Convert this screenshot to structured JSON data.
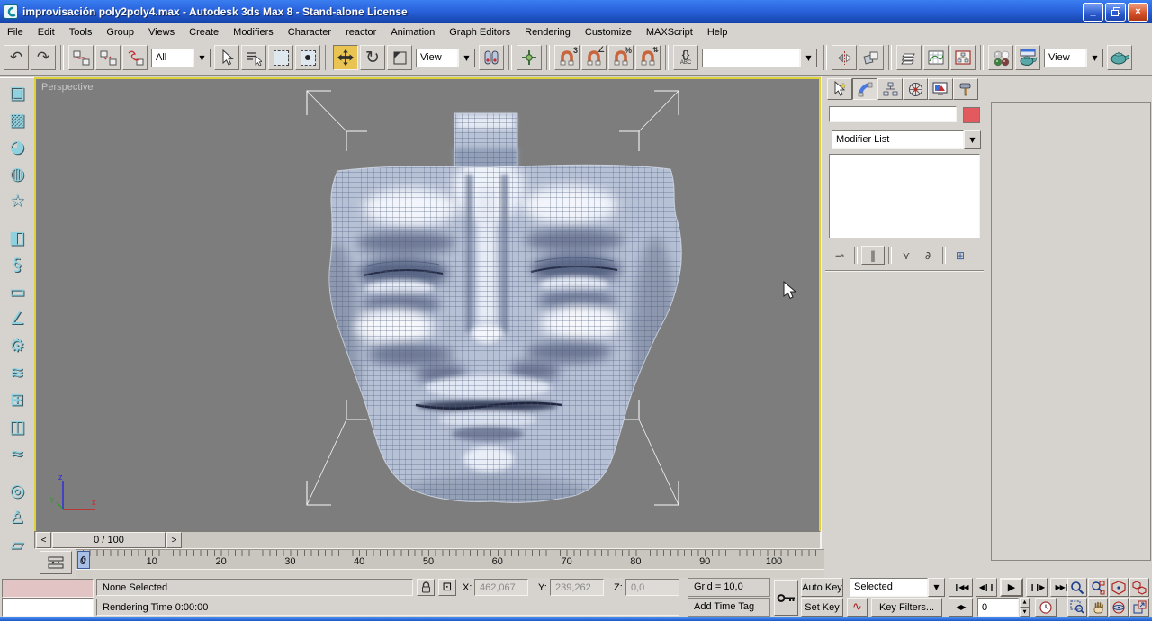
{
  "window": {
    "title": "improvisación poly2poly4.max - Autodesk 3ds Max 8  - Stand-alone License",
    "minimize_glyph": "_",
    "close_glyph": "×"
  },
  "menu": {
    "items": [
      "File",
      "Edit",
      "Tools",
      "Group",
      "Views",
      "Create",
      "Modifiers",
      "Character",
      "reactor",
      "Animation",
      "Graph Editors",
      "Rendering",
      "Customize",
      "MAXScript",
      "Help"
    ]
  },
  "toolbar": {
    "undo_glyph": "↶",
    "redo_glyph": "↷",
    "selection_filter": "All",
    "coord_system": "View",
    "rotate_glyph": "↻",
    "snap_label": "3",
    "angle_glyph": "∠",
    "percent_label": "%",
    "spinner_glyph": "⇅",
    "named_sel_braces": "{}",
    "named_sel_abc": "ABC",
    "named_selection_value": "",
    "render_type": "View",
    "dropdown_glyph": "▼"
  },
  "left_toolbar": {
    "items": [
      {
        "name": "reactor-rigid-body-collection-icon",
        "glyph": "▣"
      },
      {
        "name": "reactor-cloth-collection-icon",
        "glyph": "▩"
      },
      {
        "name": "reactor-soft-body-collection-icon",
        "glyph": "◕"
      },
      {
        "name": "reactor-rope-collection-icon",
        "glyph": "◍"
      },
      {
        "name": "reactor-deforming-mesh-icon",
        "glyph": "☆"
      },
      {
        "name": "reactor-fracture-icon",
        "glyph": "◧"
      },
      {
        "name": "reactor-spring-icon",
        "glyph": "§"
      },
      {
        "name": "reactor-dashpot-icon",
        "glyph": "▭"
      },
      {
        "name": "reactor-hinge-icon",
        "glyph": "∠"
      },
      {
        "name": "reactor-motor-icon",
        "glyph": "⚙"
      },
      {
        "name": "reactor-wind-icon",
        "glyph": "≋"
      },
      {
        "name": "reactor-toy-car-icon",
        "glyph": "⊞"
      },
      {
        "name": "reactor-plank-icon",
        "glyph": "◫"
      },
      {
        "name": "reactor-water-icon",
        "glyph": "≈"
      },
      {
        "name": "reactor-preview-animation-icon",
        "glyph": "◎"
      },
      {
        "name": "reactor-create-ragdoll-icon",
        "glyph": "♙"
      },
      {
        "name": "reactor-utilities-icon",
        "glyph": "▱"
      }
    ]
  },
  "viewport": {
    "label": "Perspective",
    "axis_x": "x",
    "axis_y": "y",
    "axis_z": "z"
  },
  "command_panel": {
    "object_name_value": "",
    "modifier_list_label": "Modifier List",
    "pin_glyph": "⊸",
    "show_end_glyph": "‖",
    "make_unique_glyph": "⋎",
    "remove_glyph": "∂",
    "configure_glyph": "⊞"
  },
  "timeline": {
    "frame_display": "0 / 100",
    "prev_glyph": "<",
    "next_glyph": ">",
    "slider_frame": "0",
    "ruler_labels": [
      "0",
      "10",
      "20",
      "30",
      "40",
      "50",
      "60",
      "70",
      "80",
      "90",
      "100"
    ]
  },
  "status": {
    "selection": "None Selected",
    "prompt": "Rendering Time  0:00:00",
    "abs_mode_glyph": "⊡",
    "x_label": "X:",
    "x_value": "462,067",
    "y_label": "Y:",
    "y_value": "239,262",
    "z_label": "Z:",
    "z_value": "0,0",
    "grid": "Grid = 10,0",
    "add_time_tag": "Add Time Tag"
  },
  "anim": {
    "auto_key": "Auto Key",
    "set_key": "Set Key",
    "key_mode_selected": "Selected",
    "curve_glyph": "∿",
    "key_filters": "Key Filters...",
    "go_start_glyph": "❙◀◀",
    "prev_key_glyph": "◀❙❙",
    "play_glyph": "▶",
    "next_key_glyph": "❙❙▶",
    "go_end_glyph": "▶▶❙",
    "key_step_glyph": "◀▶",
    "frame_value": "0",
    "spin_up_glyph": "▲",
    "spin_down_glyph": "▼"
  },
  "colors": {
    "active_viewport_border": "#ddd23a",
    "object_color_swatch": "#e25a5e",
    "viewport_background": "#7d7d7d",
    "autokey_accent": "#d6d3ce"
  }
}
